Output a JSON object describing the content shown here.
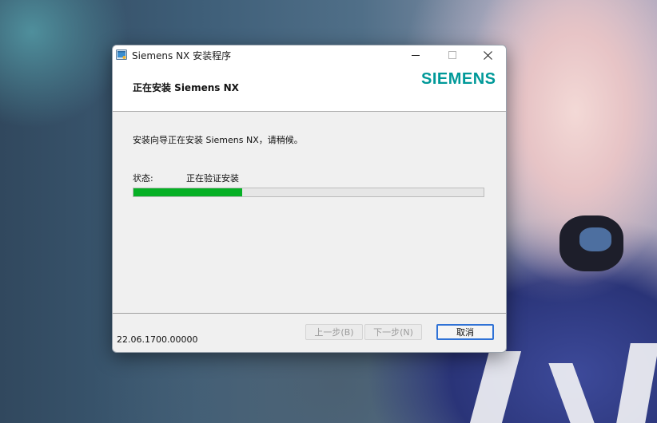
{
  "window": {
    "title": "Siemens NX 安装程序",
    "header_title": "正在安装 Siemens NX",
    "logo_text": "SIEMENS",
    "brand_color": "#009999"
  },
  "main": {
    "message": "安装向导正在安装 Siemens NX，请稍候。",
    "status_label": "状态:",
    "status_value": "正在验证安装",
    "progress_fraction": 0.31,
    "progress_color": "#06b025"
  },
  "footer": {
    "version": "22.06.1700.00000",
    "back_label": "上一步(B)",
    "next_label": "下一步(N)",
    "cancel_label": "取消"
  },
  "titlebar_controls": {
    "minimize_icon": "minimize-icon",
    "maximize_icon": "maximize-icon",
    "close_icon": "close-icon"
  }
}
